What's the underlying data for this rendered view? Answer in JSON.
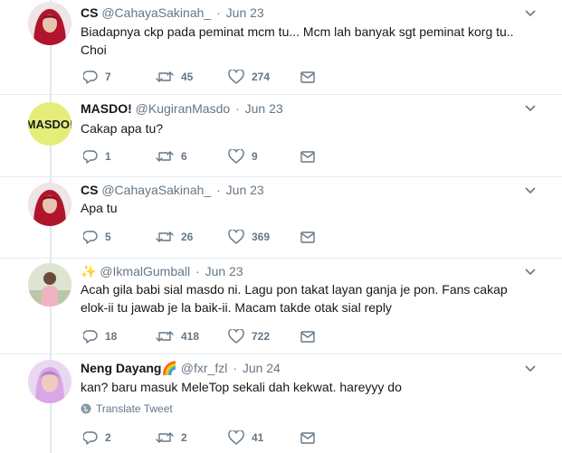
{
  "tweets": [
    {
      "name": "CS",
      "handle": "@CahayaSakinah_",
      "date": "Jun 23",
      "text": "Biadapnya ckp pada peminat mcm tu... Mcm lah banyak sgt peminat korg tu.. Choi",
      "replies": "7",
      "retweets": "45",
      "likes": "274"
    },
    {
      "name": "MASDO!",
      "handle": "@KugiranMasdo",
      "date": "Jun 23",
      "text": "Cakap apa tu?",
      "avatar_text": "MASDO!",
      "replies": "1",
      "retweets": "6",
      "likes": "9"
    },
    {
      "name": "CS",
      "handle": "@CahayaSakinah_",
      "date": "Jun 23",
      "text": "Apa tu",
      "replies": "5",
      "retweets": "26",
      "likes": "369"
    },
    {
      "name": "✨",
      "handle": "@IkmalGumball",
      "date": "Jun 23",
      "text": "Acah gila babi sial masdo ni. Lagu pon takat layan ganja je pon. Fans cakap elok-ii tu jawab je la baik-ii. Macam takde otak sial reply",
      "replies": "18",
      "retweets": "418",
      "likes": "722"
    },
    {
      "name": "Neng Dayang🌈",
      "handle": "@fxr_fzl",
      "date": "Jun 24",
      "text": "kan? baru masuk MeleTop sekali dah kekwat. hareyyy do",
      "translate": "Translate Tweet",
      "replies": "2",
      "retweets": "2",
      "likes": "41"
    }
  ],
  "colors": {
    "text": "#14171a",
    "secondary": "#657786",
    "divider": "#e6ecf0",
    "masdo_bg": "#e4ed7a"
  }
}
